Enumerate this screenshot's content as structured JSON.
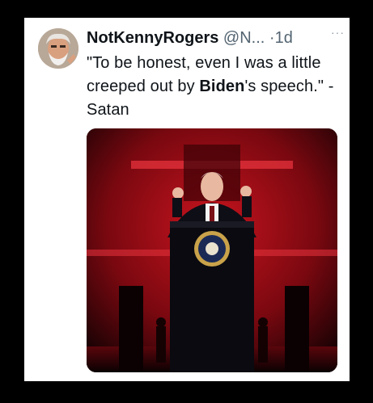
{
  "tweet": {
    "display_name": "NotKennyRogers",
    "handle": "@N...",
    "separator": "·",
    "age": "1d",
    "more_label": "···",
    "text_part1": "\"To be honest, even I was a little creeped out by ",
    "text_bold": "Biden",
    "text_part2": "'s speech.\" - Satan"
  },
  "colors": {
    "background": "#000000",
    "card": "#ffffff",
    "text": "#0f1419",
    "muted": "#536471",
    "scene_red": "#b3121c"
  },
  "icons": {
    "avatar": "profile-photo",
    "more": "ellipsis-icon"
  }
}
